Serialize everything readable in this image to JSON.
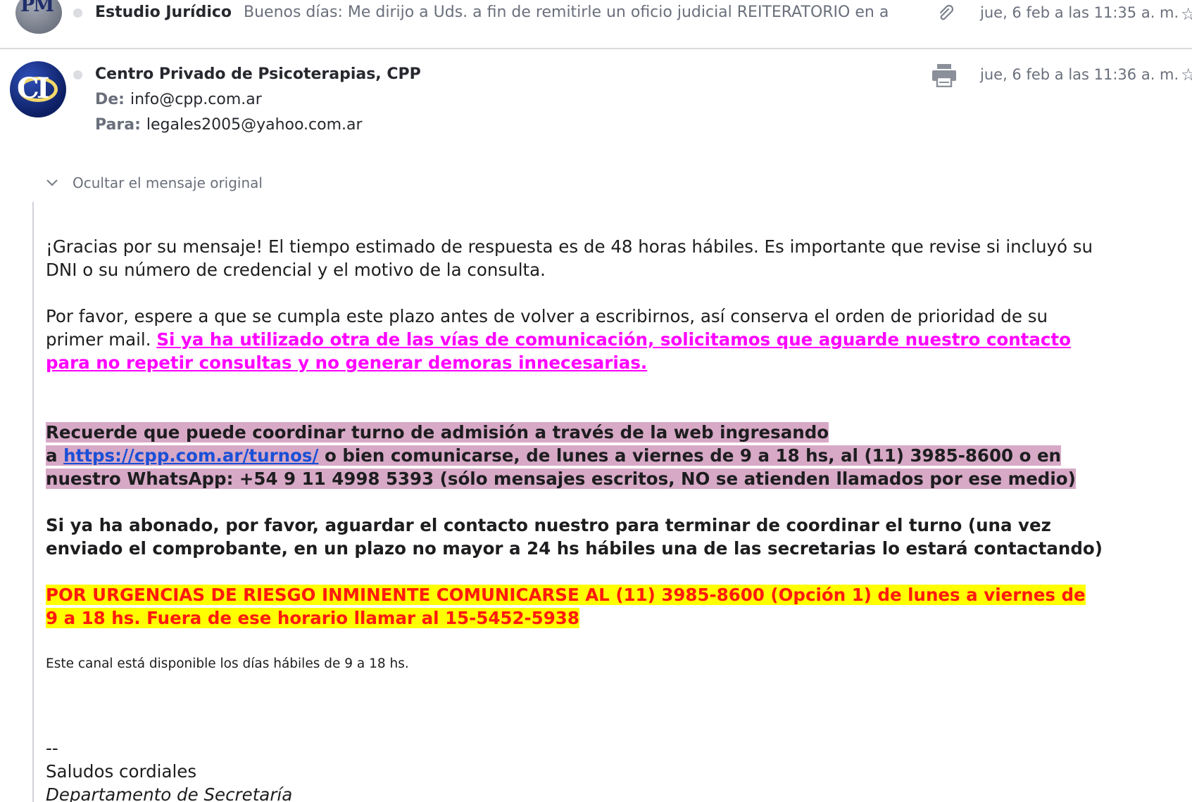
{
  "previous_message": {
    "avatar_initials": "PM",
    "sender": "Estudio Jurídico",
    "snippet": "Buenos días: Me dirijo a Uds. a fin de remitirle un oficio judicial REITERATORIO en a",
    "date": "jue, 6 feb a las 11:35 a. m.",
    "attachment_icon": "paperclip-icon",
    "star_icon": "star-icon"
  },
  "message": {
    "avatar_initials": "CI",
    "sender": "Centro Privado de Psicoterapias, CPP",
    "from_label": "De:",
    "from_value": "info@cpp.com.ar",
    "to_label": "Para:",
    "to_value": "legales2005@yahoo.com.ar",
    "date": "jue, 6 feb a las 11:36 a. m.",
    "print_icon": "printer-icon",
    "star_icon": "star-icon"
  },
  "toggle": {
    "label": "Ocultar el mensaje original",
    "icon": "chevron-down-icon"
  },
  "body": {
    "p1_line1": "¡Gracias por su mensaje! El tiempo estimado de respuesta es de 48 horas hábiles. Es importante que revise si incluyó su",
    "p1_line2": "DNI o su número de credencial y el motivo de la consulta.",
    "p2_line1": "Por favor, espere a que se cumpla este plazo antes de volver a escribirnos, así conserva el orden de prioridad de su",
    "p2_line2_plain": "primer mail.",
    "p2_line2_pink": "Si ya ha utilizado otra de las vías de comunicación, solicitamos que aguarde nuestro contacto",
    "p2_line3_pink": "para no repetir consultas y no generar demoras innecesarias.",
    "p3_line1": "Recuerde que puede coordinar turno de admisión a través de la web ingresando",
    "p3_line2_pre": "a",
    "p3_link": "https://cpp.com.ar/turnos/",
    "p3_line2_post": "o bien comunicarse, de lunes a viernes de 9 a 18 hs,  al (11) 3985-8600 o en",
    "p3_line3": "nuestro WhatsApp: +54 9 11 4998 5393 (sólo mensajes escritos, NO se atienden llamados por ese medio)",
    "p4_line1": "Si ya ha abonado, por favor, aguardar el contacto nuestro para terminar de coordinar el turno (una vez",
    "p4_line2": "enviado el comprobante, en un plazo no mayor a 24 hs hábiles una de las secretarias lo estará contactando)",
    "p5_line1": "POR URGENCIAS DE RIESGO INMINENTE COMUNICARSE AL (11) 3985-8600 (Opción 1) de lunes a viernes de",
    "p5_line2": "9 a 18 hs. Fuera de ese horario llamar al 15-5452-5938",
    "p6": "Este canal está disponible los días hábiles de 9 a 18 hs.",
    "sig_dash": "--",
    "sig_greeting": "Saludos cordiales",
    "sig_dept": "Departamento de Secretaría"
  }
}
